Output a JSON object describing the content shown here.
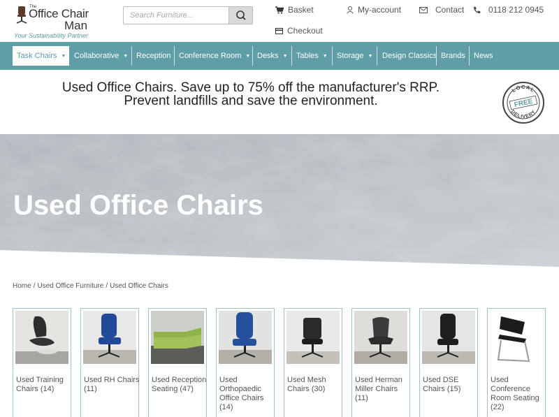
{
  "logo": {
    "the": "The",
    "line1": "Office Chair",
    "line2": "Man",
    "tagline": "Your Sustainability Partner"
  },
  "search": {
    "placeholder": "Search Furniture..."
  },
  "header_links": {
    "basket": "Basket",
    "account": "My-account",
    "contact": "Contact",
    "phone": "0118 212 0945",
    "checkout": "Checkout"
  },
  "nav": [
    {
      "label": "Task Chairs",
      "caret": "▼",
      "active": true
    },
    {
      "label": "Collaborative",
      "caret": "▼"
    },
    {
      "label": "Reception",
      "caret": ""
    },
    {
      "label": "Conference Room",
      "caret": "▼"
    },
    {
      "label": "Desks",
      "caret": "▼"
    },
    {
      "label": "Tables",
      "caret": "▼"
    },
    {
      "label": "Storage",
      "caret": "▼"
    },
    {
      "label": "Design Classics",
      "caret": ""
    },
    {
      "label": "Brands",
      "caret": ""
    },
    {
      "label": "News",
      "caret": ""
    }
  ],
  "promo": {
    "line1": "Used Office Chairs. Save up to 75% off the manufacturer's RRP.",
    "line2": "Prevent landfills and save the environment.",
    "stamp_top": "LOCAL",
    "stamp_mid": "FREE",
    "stamp_bottom": "DELIVERY"
  },
  "hero": {
    "title": "Used Office Chairs"
  },
  "breadcrumb": {
    "home": "Home",
    "sep": "/",
    "level1": "Used Office Furniture",
    "level2": "Used Office Chairs"
  },
  "products": [
    {
      "name": "Used Training Chairs (14)"
    },
    {
      "name": "Used RH Chairs (11)"
    },
    {
      "name": "Used Reception Seating (47)"
    },
    {
      "name": "Used Orthopaedic Office Chairs (14)"
    },
    {
      "name": "Used Mesh Chairs (30)"
    },
    {
      "name": "Used Herman Miller Chairs (11)"
    },
    {
      "name": "Used DSE Chairs (15)"
    },
    {
      "name": "Used Conference Room Seating (22)"
    }
  ],
  "colors": {
    "accent": "#5f9ea6",
    "border": "#9fc4c8"
  }
}
